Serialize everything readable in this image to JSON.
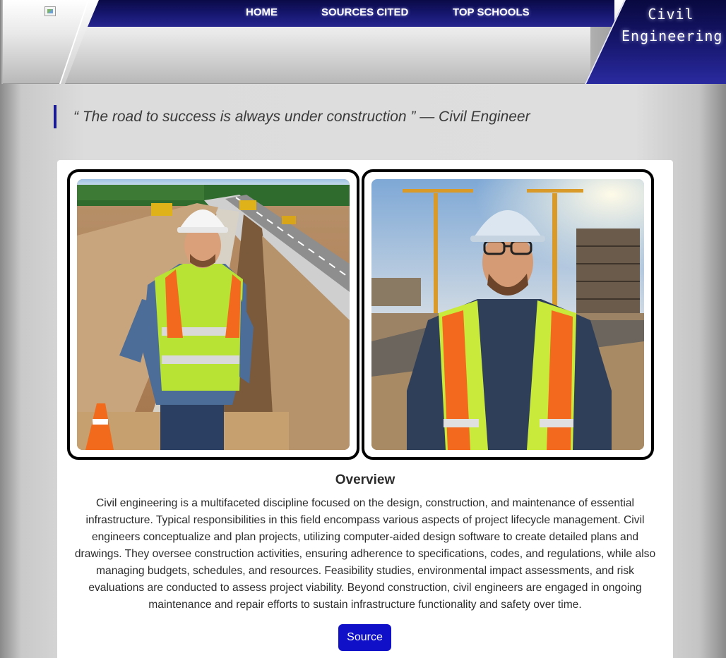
{
  "header": {
    "logo_alt": "",
    "nav": [
      {
        "label": "HOME"
      },
      {
        "label": "SOURCES CITED"
      },
      {
        "label": "TOP SCHOOLS"
      }
    ],
    "title_line1": "Civil",
    "title_line2": "Engineering"
  },
  "quote": {
    "text": "“ The road to success is always under construction ” — Civil Engineer"
  },
  "photos": [
    {
      "icon": "photo-engineer-highway"
    },
    {
      "icon": "photo-engineer-crane"
    }
  ],
  "overview": {
    "heading": "Overview",
    "body": "Civil engineering is a multifaceted discipline focused on the design, construction, and maintenance of essential infrastructure. Typical responsibilities in this field encompass various aspects of project lifecycle management. Civil engineers conceptualize and plan projects, utilizing computer-aided design software to create detailed plans and drawings. They oversee construction activities, ensuring adherence to specifications, codes, and regulations, while also managing budgets, schedules, and resources. Feasibility studies, environmental impact assessments, and risk evaluations are conducted to assess project viability. Beyond construction, civil engineers are engaged in ongoing maintenance and repair efforts to sustain infrastructure functionality and safety over time.",
    "source_label": "Source"
  },
  "colors": {
    "nav_blue": "#141468",
    "button_blue": "#1010c8",
    "quote_bar": "#1a1a90"
  }
}
